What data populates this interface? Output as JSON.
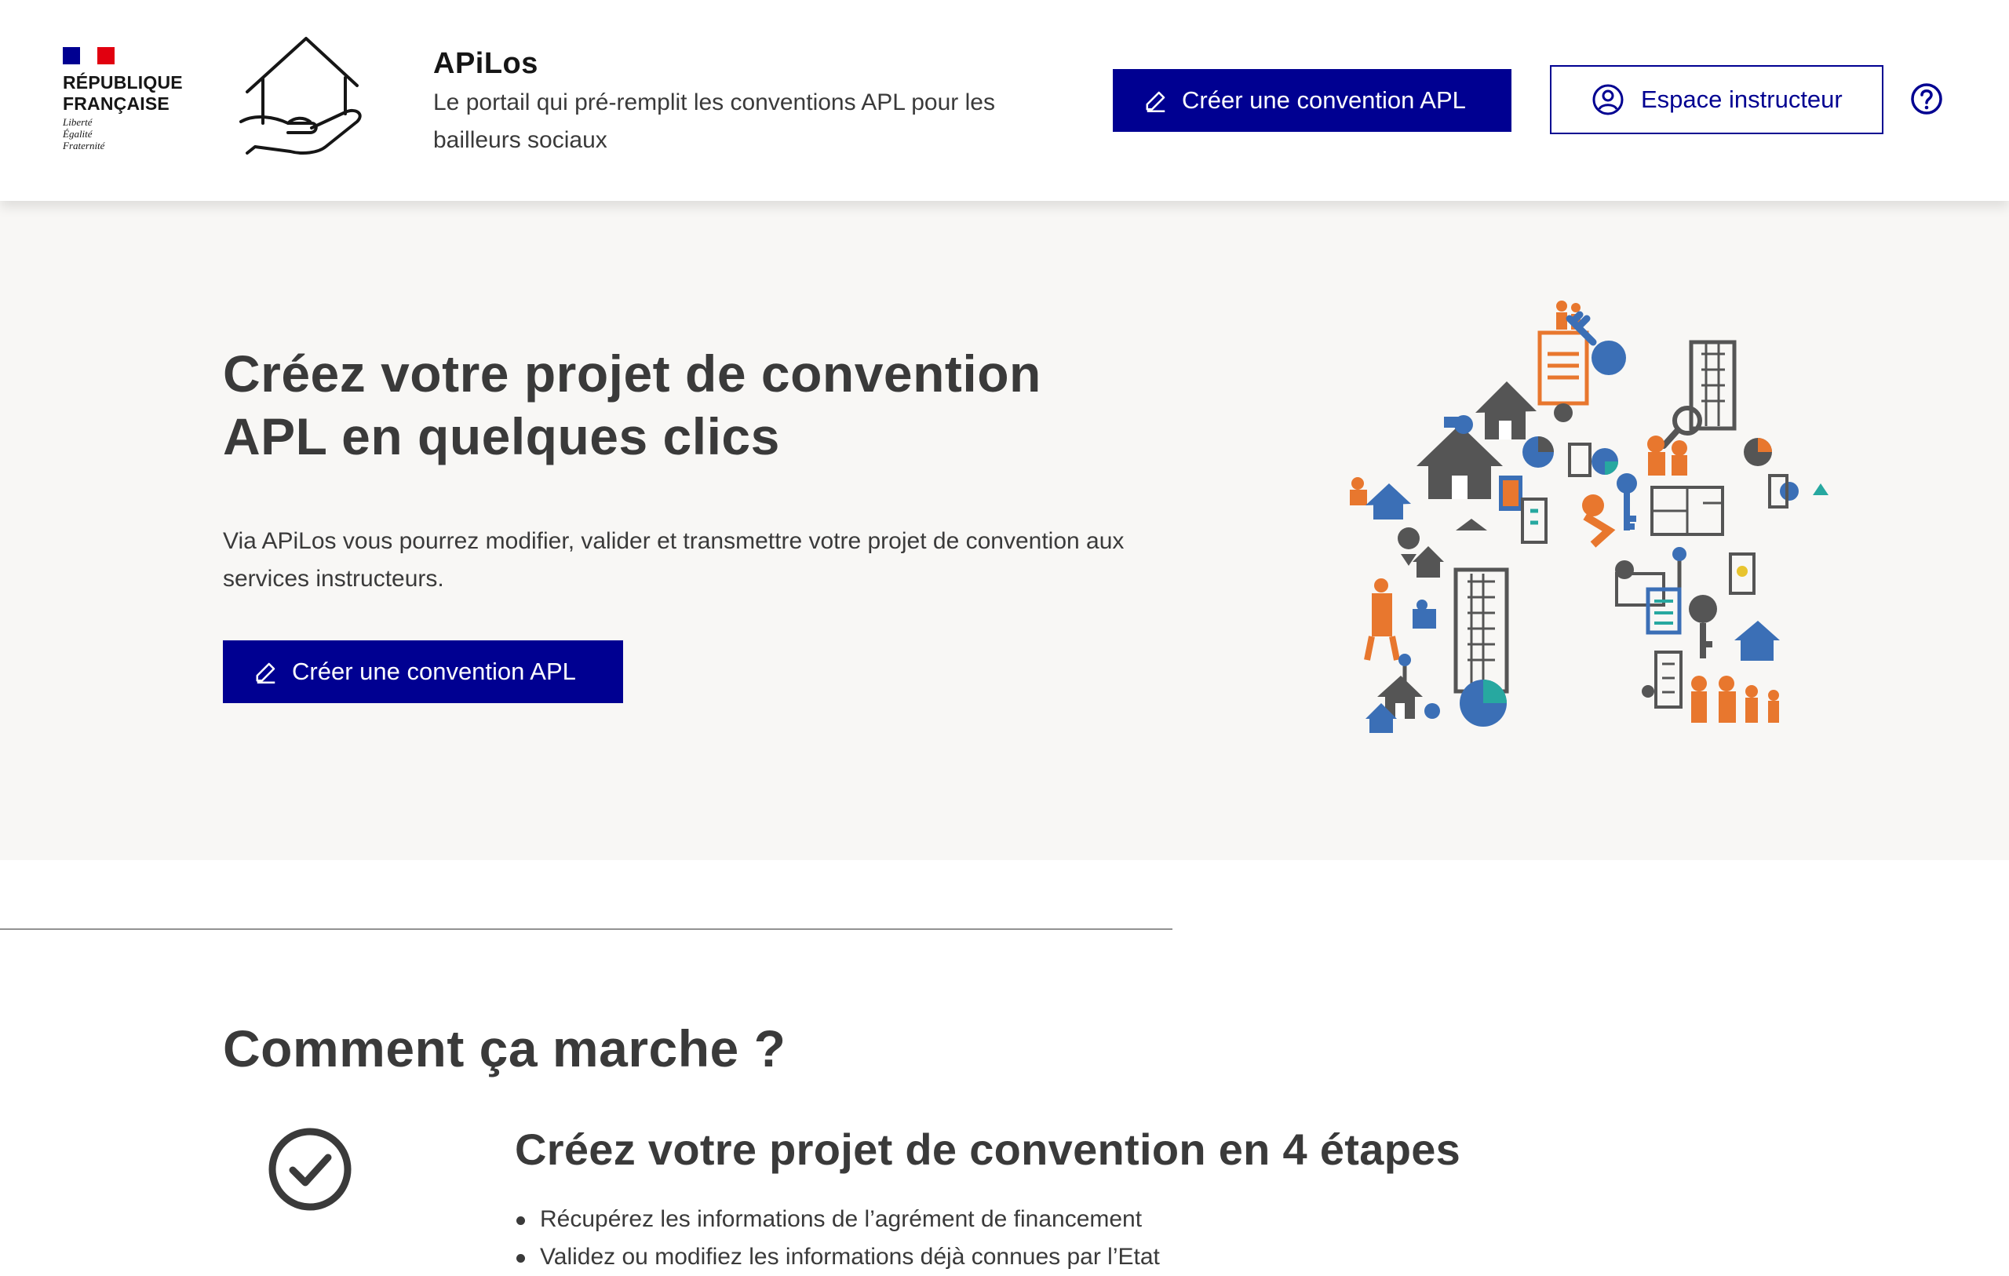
{
  "header": {
    "republic": {
      "name": "RÉPUBLIQUE\nFRANÇAISE",
      "motto": "Liberté\nÉgalité\nFraternité"
    },
    "service_title": "APiLos",
    "service_tagline": "Le portail qui pré-remplit les conventions APL pour les bailleurs sociaux",
    "create_button_label": "Créer une convention APL",
    "instructor_button_label": "Espace instructeur",
    "icons": {
      "logo": "house-in-hand-icon",
      "create": "pencil-icon",
      "instructor": "user-circle-icon",
      "help": "question-circle-icon"
    }
  },
  "hero": {
    "title": "Créez votre projet de convention APL en quelques clics",
    "text": "Via APiLos vous pourrez modifier, valider et transmettre votre projet de convention aux services instructeurs.",
    "button_label": "Créer une convention APL",
    "illustration": "house-icons-mosaic"
  },
  "how_it_works": {
    "title": "Comment ça marche ?",
    "step_icon": "check-circle-icon",
    "step_title": "Créez votre projet de convention en 4 étapes",
    "steps": [
      "Récupérez les informations de l’agrément de financement",
      "Validez ou modifiez les informations déjà connues par l’Etat"
    ]
  },
  "colors": {
    "primary": "#000091",
    "hero_background": "#f8f7f5",
    "text": "#3a3a3a",
    "mosaic_orange": "#e8772e",
    "mosaic_blue": "#3b6fb6",
    "mosaic_grey": "#555555"
  }
}
